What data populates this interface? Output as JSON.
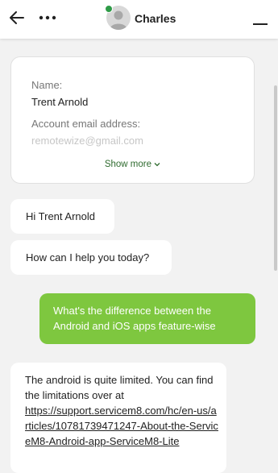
{
  "header": {
    "agent_name": "Charles",
    "icons": [
      "back-arrow-icon",
      "more-icon",
      "avatar",
      "minimize-icon"
    ],
    "status_color": "#2e9b47"
  },
  "info_card": {
    "name_label": "Name:",
    "name_value": "Trent Arnold",
    "email_label": "Account email address:",
    "email_value": "remotewize@gmail.com",
    "show_more_label": "Show more",
    "show_more_icon": "chevron-down-icon"
  },
  "messages": [
    {
      "from": "agent",
      "text": "Hi Trent Arnold"
    },
    {
      "from": "agent",
      "text": "How can I help you today?"
    },
    {
      "from": "user",
      "text": "What's the difference between the Android and iOS apps feature-wise"
    },
    {
      "from": "agent",
      "text": "The android is quite limited. You can find the limitations over at",
      "link": "https://support.servicem8.com/hc/en-us/articles/10781739471247-About-the-ServiceM8-Android-app-ServiceM8-Lite"
    }
  ],
  "colors": {
    "user_bubble": "#7ec73f",
    "background": "#f2f2f2",
    "link_text": "#2f6b2f"
  }
}
